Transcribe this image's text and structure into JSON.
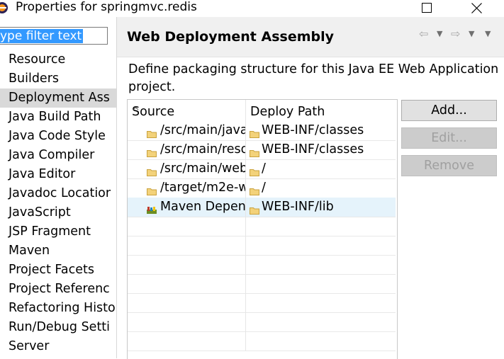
{
  "window": {
    "title": "Properties for springmvc.redis"
  },
  "filter": {
    "value": "ype filter text"
  },
  "nav_items": [
    {
      "label": "Resource",
      "has_arrow": true
    },
    {
      "label": "Builders",
      "has_arrow": false
    },
    {
      "label": "Deployment Ass",
      "has_arrow": false,
      "selected": true
    },
    {
      "label": "Java Build Path",
      "has_arrow": false
    },
    {
      "label": "Java Code Style",
      "has_arrow": true
    },
    {
      "label": "Java Compiler",
      "has_arrow": true
    },
    {
      "label": "Java Editor",
      "has_arrow": true
    },
    {
      "label": "Javadoc Locatior",
      "has_arrow": false
    },
    {
      "label": "JavaScript",
      "has_arrow": true
    },
    {
      "label": "JSP Fragment",
      "has_arrow": false
    },
    {
      "label": "Maven",
      "has_arrow": true
    },
    {
      "label": "Project Facets",
      "has_arrow": false
    },
    {
      "label": "Project Referenc",
      "has_arrow": false
    },
    {
      "label": "Refactoring Histo",
      "has_arrow": false
    },
    {
      "label": "Run/Debug Setti",
      "has_arrow": false
    },
    {
      "label": "Server",
      "has_arrow": false
    }
  ],
  "page": {
    "title": "Web Deployment Assembly",
    "description": "Define packaging structure for this Java EE Web Application project."
  },
  "table": {
    "col_source": "Source",
    "col_deploy": "Deploy Path",
    "rows": [
      {
        "source": "/src/main/java",
        "deploy": "WEB-INF/classes",
        "icon": "folder-icon"
      },
      {
        "source": "/src/main/reso",
        "deploy": "WEB-INF/classes",
        "icon": "folder-icon"
      },
      {
        "source": "/src/main/web",
        "deploy": "/",
        "icon": "folder-icon"
      },
      {
        "source": "/target/m2e-w",
        "deploy": "/",
        "icon": "folder-icon"
      },
      {
        "source": "Maven Depend",
        "deploy": "WEB-INF/lib",
        "icon": "maven-library-icon",
        "selected": true
      }
    ]
  },
  "buttons": {
    "add": "Add...",
    "edit": "Edit...",
    "remove": "Remove"
  },
  "colors": {
    "selection_blue": "#3399ff",
    "row_highlight": "#e5f3fb",
    "folder_yellow": "#e8c05a"
  }
}
